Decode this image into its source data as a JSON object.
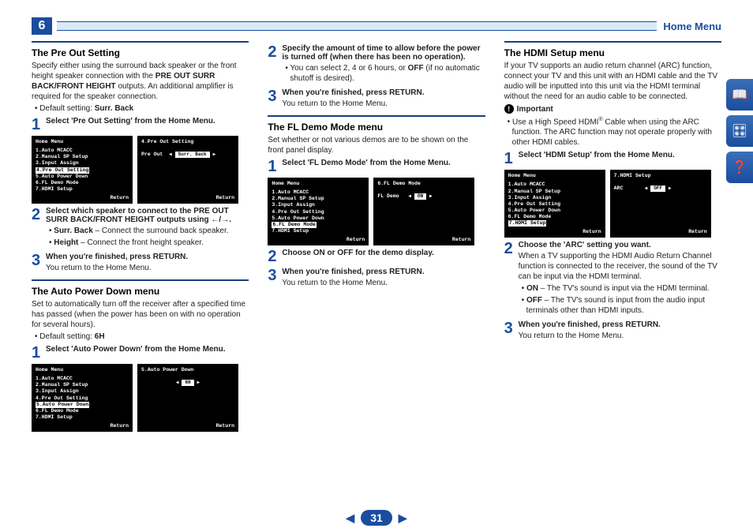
{
  "header": {
    "chapter": "6",
    "title": "Home Menu"
  },
  "page_number": "31",
  "side_icons": [
    "📖",
    "🎛",
    "❓"
  ],
  "menu_items": [
    "1.Auto MCACC",
    "2.Manual SP Setup",
    "3.Input Assign",
    "4.Pre Out Setting",
    "5.Auto Power Down",
    "6.FL Demo Mode",
    "7.HDMI Setup"
  ],
  "common": {
    "home": "Home Menu",
    "return": "Return"
  },
  "col1": {
    "preout": {
      "title": "The Pre Out Setting",
      "desc_a": "Specify either using the surround back speaker or the front height speaker connection with the ",
      "desc_b": "PRE OUT SURR BACK/FRONT HEIGHT",
      "desc_c": " outputs. An additional amplifier is required for the speaker connection.",
      "default": "Default setting: ",
      "default_v": "Surr. Back",
      "step1": "Select 'Pre Out Setting' from the Home Menu.",
      "osd2_title": "4.Pre Out Setting",
      "osd2_label": "Pre Out",
      "osd2_val": "Surr. Back",
      "step2": "Select which speaker to connect to the PRE OUT SURR BACK/FRONT HEIGHT outputs using ←/→.",
      "opt1a": "Surr. Back",
      "opt1b": " – Connect the surround back speaker.",
      "opt2a": "Height",
      "opt2b": " – Connect the front height speaker.",
      "step3": "When you're finished, press RETURN.",
      "ret": "You return to the Home Menu."
    },
    "apd": {
      "title": "The Auto Power Down menu",
      "desc": "Set to automatically turn off the receiver after a specified time has passed (when the power has been on with no operation for several hours).",
      "default": "Default setting: ",
      "default_v": "6H",
      "step1": "Select 'Auto Power Down' from the Home Menu.",
      "osd2_title": "5.Auto Power Down",
      "osd2_val": "6H"
    }
  },
  "col2": {
    "step2": "Specify the amount of time to allow before the power is turned off (when there has been no operation).",
    "opt": "You can select 2, 4 or 6 hours, or ",
    "opt_b": "OFF",
    "opt_c": " (if no automatic shutoff is desired).",
    "step3": "When you're finished, press RETURN.",
    "ret": "You return to the Home Menu.",
    "fl": {
      "title": "The FL Demo Mode menu",
      "desc": "Set whether or not various demos are to be shown on the front panel display.",
      "step1": "Select 'FL Demo Mode' from the Home Menu.",
      "osd2_title": "6.FL Demo Mode",
      "osd2_label": "FL Demo",
      "osd2_val": "ON",
      "step2": "Choose ON or OFF for the demo display.",
      "step3": "When you're finished, press RETURN.",
      "ret2": "You return to the Home Menu."
    }
  },
  "col3": {
    "hdmi": {
      "title": "The HDMI Setup menu",
      "desc": "If your TV supports an audio return channel (ARC) function, connect your TV and this unit with an HDMI cable and the TV audio will be inputted into this unit via the HDMI terminal without the need for an audio cable to be connected.",
      "important": "Important",
      "note_a": "Use a High Speed HDMI",
      "note_b": " Cable when using the ARC function. The ARC function may not operate properly with other HDMI cables.",
      "step1": "Select 'HDMI Setup' from the Home Menu.",
      "osd2_title": "7.HDMI Setup",
      "osd2_label": "ARC",
      "osd2_val": "OFF",
      "step2": "Choose the 'ARC' setting you want.",
      "note2": "When a TV supporting the HDMI Audio Return Channel function is connected to the receiver, the sound of the TV can be input via the HDMI terminal.",
      "on_a": "ON",
      "on_b": " – The TV's sound is input via the HDMI terminal.",
      "off_a": "OFF",
      "off_b": " – The TV's sound is input from the audio input terminals other than HDMI inputs.",
      "step3": "When you're finished, press RETURN.",
      "ret": "You return to the Home Menu."
    }
  }
}
